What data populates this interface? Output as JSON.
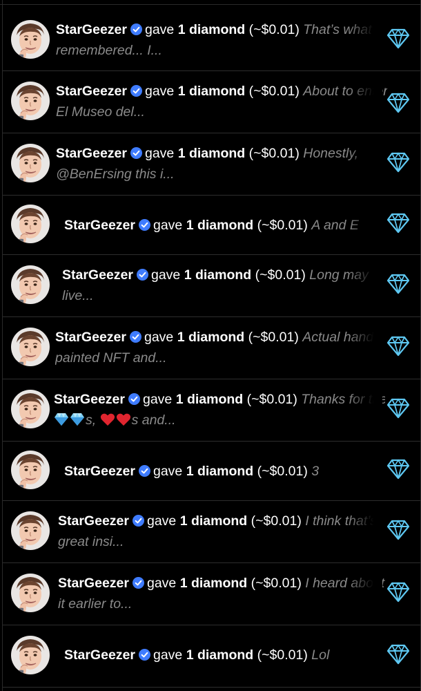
{
  "colors": {
    "background": "#000000",
    "excerpt": "#8a8a8a",
    "verified": "#3f7cff",
    "diamond": "#5ec8f2",
    "divider": "#2e2e2e"
  },
  "notifications": [
    {
      "user": "StarGeezer",
      "action": "gave",
      "amount": "1 diamond",
      "value": "(~$0.01)",
      "excerpt_line1": "That’s what I",
      "excerpt_line2": "remembered... I...",
      "icon": "diamond-icon"
    },
    {
      "user": "StarGeezer",
      "action": "gave",
      "amount": "1 diamond",
      "value": "(~$0.01)",
      "excerpt_line1": "About to enter",
      "excerpt_line2": "El Museo del...",
      "icon": "diamond-icon"
    },
    {
      "user": "StarGeezer",
      "action": "gave",
      "amount": "1 diamond",
      "value": "(~$0.01)",
      "excerpt_line1": "Honestly,",
      "excerpt_line2": "@BenErsing this i...",
      "icon": "diamond-icon"
    },
    {
      "user": "StarGeezer",
      "action": "gave",
      "amount": "1 diamond",
      "value": "(~$0.01)",
      "excerpt_line1": "A and E",
      "excerpt_line2": "",
      "icon": "diamond-icon"
    },
    {
      "user": "StarGeezer",
      "action": "gave",
      "amount": "1 diamond",
      "value": "(~$0.01)",
      "excerpt_line1": "Long may",
      "excerpt_line2": "live...",
      "icon": "diamond-icon"
    },
    {
      "user": "StarGeezer",
      "action": "gave",
      "amount": "1 diamond",
      "value": "(~$0.01)",
      "excerpt_line1": "Actual hand",
      "excerpt_line2": "painted NFT and...",
      "icon": "diamond-icon"
    },
    {
      "user": "StarGeezer",
      "action": "gave",
      "amount": "1 diamond",
      "value": "(~$0.01)",
      "excerpt_line1": "Thanks for the",
      "excerpt_line2_gem_part": "s, ",
      "excerpt_line2_heart_part": "s and...",
      "icon": "diamond-icon"
    },
    {
      "user": "StarGeezer",
      "action": "gave",
      "amount": "1 diamond",
      "value": "(~$0.01)",
      "excerpt_line1": "3",
      "excerpt_line2": "",
      "icon": "diamond-icon"
    },
    {
      "user": "StarGeezer",
      "action": "gave",
      "amount": "1 diamond",
      "value": "(~$0.01)",
      "excerpt_line1": "I think that’s",
      "excerpt_line2": "great insi...",
      "icon": "diamond-icon"
    },
    {
      "user": "StarGeezer",
      "action": "gave",
      "amount": "1 diamond",
      "value": "(~$0.01)",
      "excerpt_line1": "I heard about",
      "excerpt_line2": "it earlier to...",
      "icon": "diamond-icon"
    },
    {
      "user": "StarGeezer",
      "action": "gave",
      "amount": "1 diamond",
      "value": "(~$0.01)",
      "excerpt_line1": "Lol",
      "excerpt_line2": "",
      "icon": "diamond-icon"
    }
  ]
}
